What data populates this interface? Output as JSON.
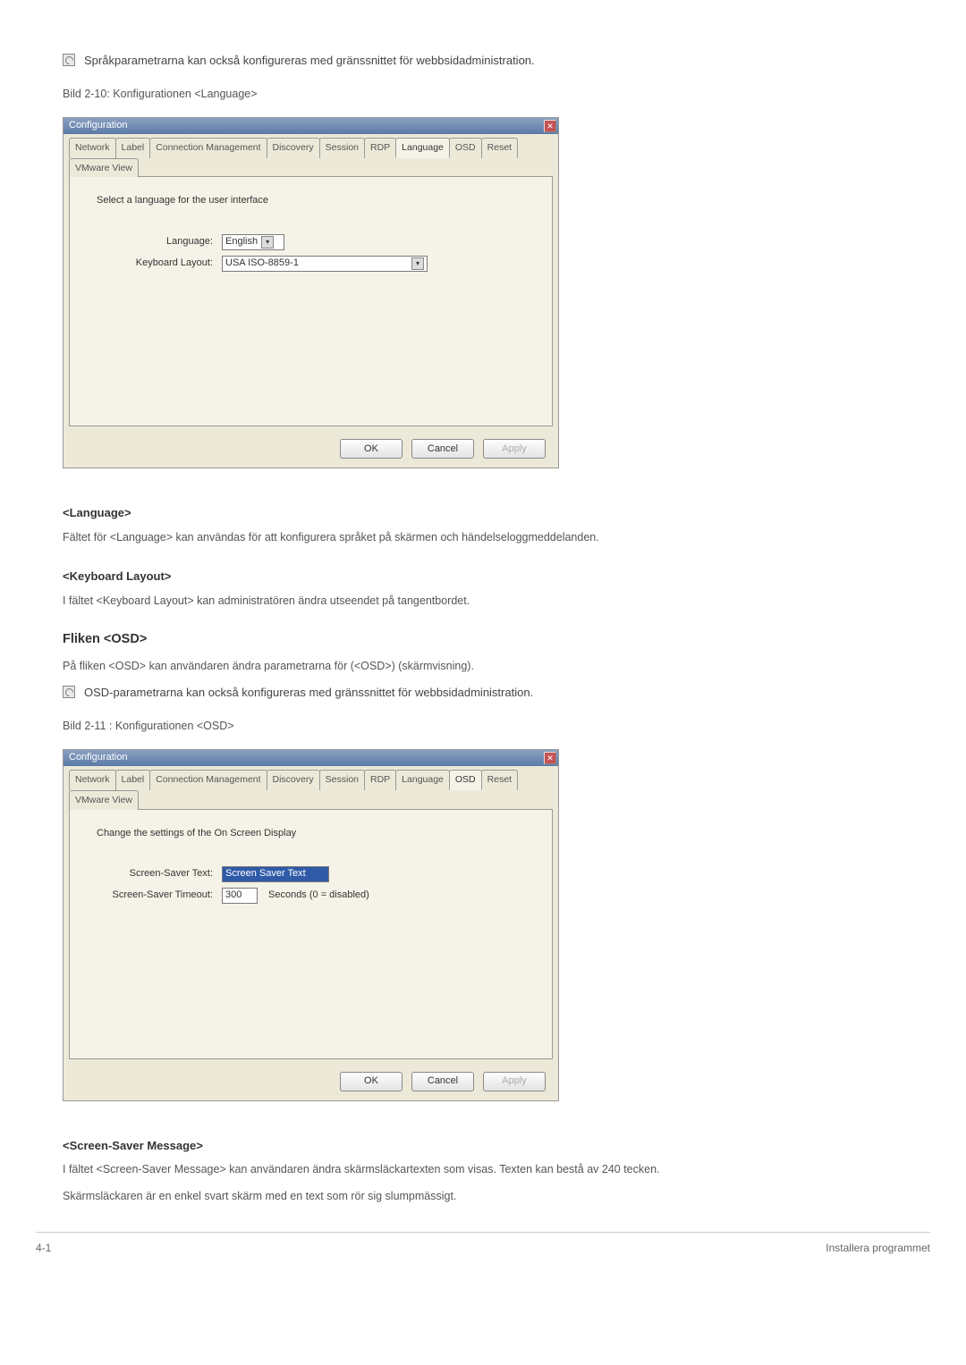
{
  "notes": {
    "note1": "Språkparametrarna kan också konfigureras med gränssnittet för webbsidadministration.",
    "note2": "OSD-parametrarna kan också konfigureras med gränssnittet för webbsidadministration."
  },
  "captions": {
    "fig1": "Bild 2-10: Konfigurationen <Language>",
    "fig2": "Bild 2-11 : Konfigurationen <OSD>"
  },
  "dialog": {
    "title": "Configuration",
    "tabs": [
      "Network",
      "Label",
      "Connection Management",
      "Discovery",
      "Session",
      "RDP",
      "Language",
      "OSD",
      "Reset",
      "VMware View"
    ],
    "panel_language": {
      "intro": "Select a language for the user interface",
      "language_label": "Language:",
      "language_value": "English",
      "keyboard_label": "Keyboard Layout:",
      "keyboard_value": "USA ISO-8859-1"
    },
    "panel_osd": {
      "intro": "Change the settings of the On Screen Display",
      "saver_text_label": "Screen-Saver Text:",
      "saver_text_value": "Screen Saver Text",
      "timeout_label": "Screen-Saver Timeout:",
      "timeout_value": "300",
      "timeout_suffix": "Seconds (0 = disabled)"
    },
    "buttons": {
      "ok": "OK",
      "cancel": "Cancel",
      "apply": "Apply"
    }
  },
  "sections": {
    "lang_heading": "<Language>",
    "lang_text": "Fältet för <Language> kan användas för att konfigurera språket på skärmen och händelseloggmeddelanden.",
    "keyboard_heading": "<Keyboard Layout>",
    "keyboard_text": "I fältet <Keyboard Layout> kan administratören ändra utseendet på tangentbordet.",
    "osd_tab_heading": "Fliken <OSD>",
    "osd_tab_text": "På fliken <OSD> kan användaren ändra parametrarna för (<OSD>) (skärmvisning).",
    "saver_heading": "<Screen-Saver Message>",
    "saver_text1": "I fältet <Screen-Saver Message> kan användaren ändra skärmsläckartexten som visas. Texten kan bestå av 240 tecken.",
    "saver_text2": "Skärmsläckaren är en enkel svart skärm med en text som rör sig slumpmässigt."
  },
  "footer": {
    "left": "4-1",
    "right": "Installera programmet"
  }
}
